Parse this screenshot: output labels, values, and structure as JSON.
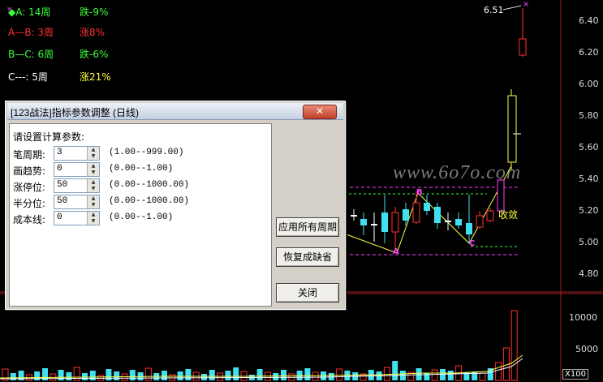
{
  "chart_area": {
    "price_ticks": [
      "6.40",
      "6.20",
      "6.00",
      "5.80",
      "5.60",
      "5.40",
      "5.20",
      "5.00",
      "4.80"
    ],
    "volume_ticks": [
      "10000",
      "5000"
    ],
    "unit": "X100",
    "high_label": "6.51",
    "markers": {
      "A": "A",
      "B": "B",
      "C": "C"
    },
    "status_label": "收敛",
    "watermark": "www.6o7o.com"
  },
  "info_lines": [
    {
      "name": "a-line",
      "left": "◆A: 14周",
      "right": "跌-9%",
      "color_left": "#39ff39",
      "color_right": "#39ff39"
    },
    {
      "name": "ab-line",
      "left": "A—B: 3周",
      "right": "涨8%",
      "color_left": "#ff3030",
      "color_right": "#ff3030"
    },
    {
      "name": "bc-line",
      "left": "B—C: 6周",
      "right": "跌-6%",
      "color_left": "#39ff39",
      "color_right": "#39ff39"
    },
    {
      "name": "c-line",
      "left": "C---: 5周",
      "right": "涨21%",
      "color_left": "#ffffff",
      "color_right": "#ffff40"
    }
  ],
  "dialog": {
    "title": "[123战法]指标参数调整 (日线)",
    "close_label": "✕",
    "heading": "请设置计算参数:",
    "params": [
      {
        "label": "笔周期:",
        "value": "3",
        "range": "(1.00--999.00)"
      },
      {
        "label": "画趋势:",
        "value": "0",
        "range": "(0.00--1.00)"
      },
      {
        "label": "涨停位:",
        "value": "50",
        "range": "(0.00--1000.00)"
      },
      {
        "label": "半分位:",
        "value": "50",
        "range": "(0.00--1000.00)"
      },
      {
        "label": "成本线:",
        "value": "0",
        "range": "(0.00--1.00)"
      }
    ],
    "buttons": {
      "apply_all": "应用所有周期",
      "restore_default": "恢复成缺省",
      "close": "关闭"
    }
  },
  "colors": {
    "bg": "#000000",
    "up": "#ff3030",
    "down": "#40e0f0",
    "green": "#39ff39",
    "magenta": "#ff40ff"
  }
}
